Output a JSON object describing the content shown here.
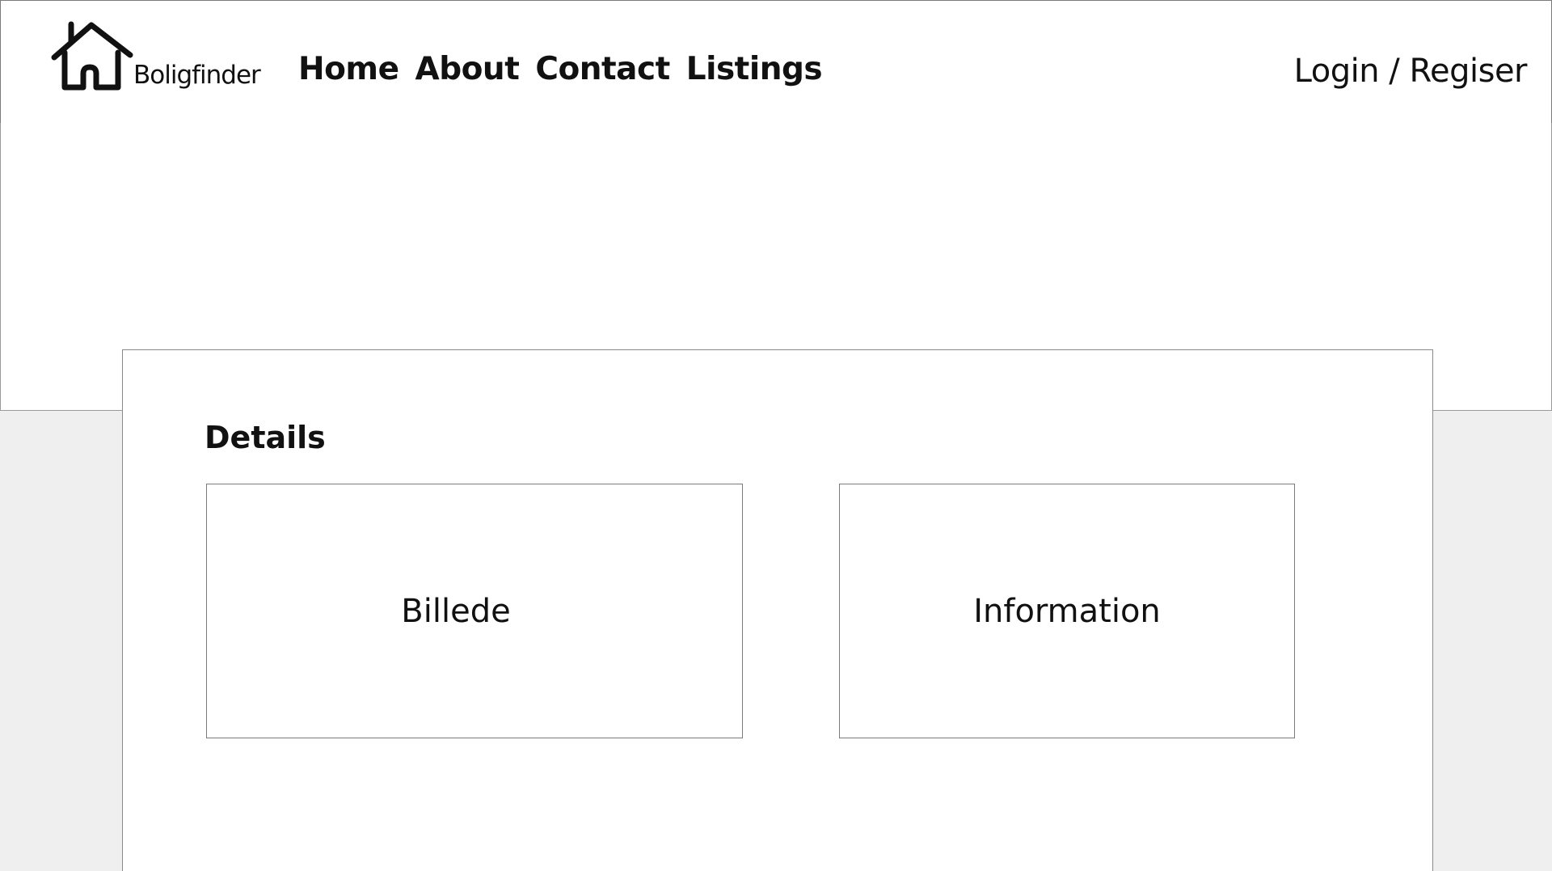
{
  "header": {
    "logo": {
      "text": "Boligfinder",
      "icon": "house-icon"
    },
    "nav": [
      {
        "label": "Home"
      },
      {
        "label": "About"
      },
      {
        "label": "Contact"
      },
      {
        "label": "Listings"
      }
    ],
    "auth_label": "Login / Regiser"
  },
  "details": {
    "title": "Details",
    "image_label": "Billede",
    "info_label": "Information"
  },
  "colors": {
    "background": "#efefef",
    "surface": "#ffffff",
    "border": "#7a7a7a",
    "text": "#111111"
  }
}
